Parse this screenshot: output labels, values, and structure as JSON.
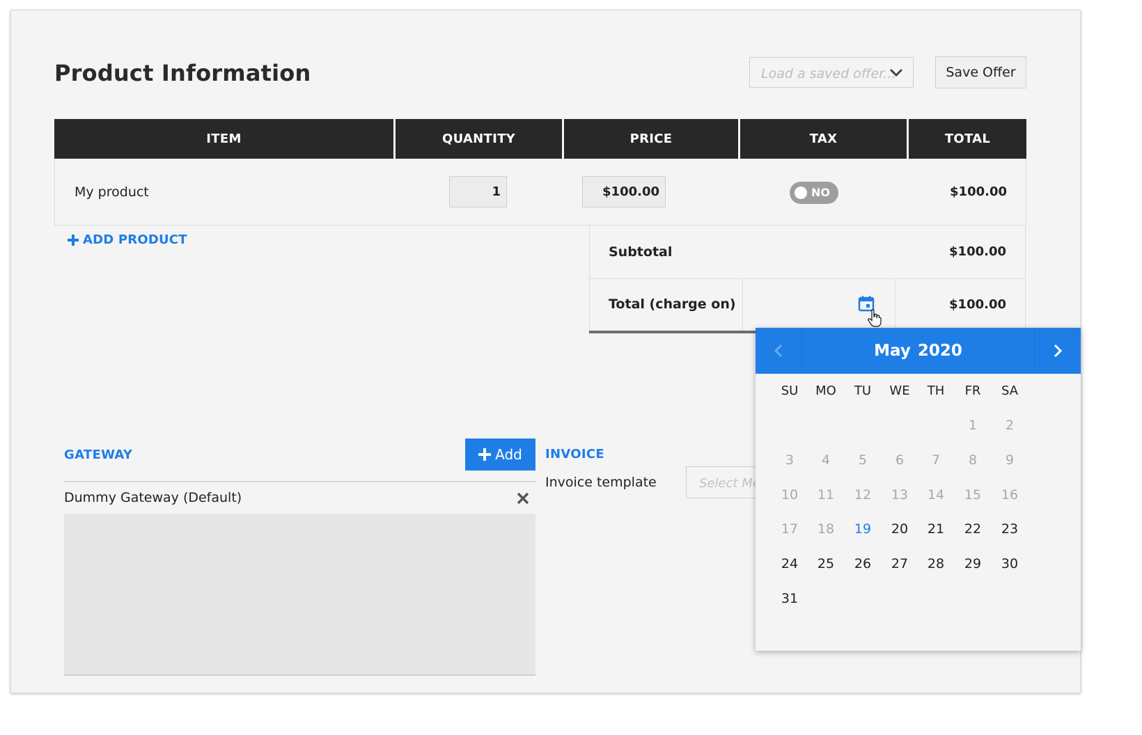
{
  "page_title": "Product Information",
  "load_offer_placeholder": "Load a saved offer...",
  "save_offer_label": "Save Offer",
  "table": {
    "headers": [
      "ITEM",
      "QUANTITY",
      "PRICE",
      "TAX",
      "TOTAL"
    ],
    "rows": [
      {
        "item": "My product",
        "quantity": "1",
        "price": "$100.00",
        "tax_toggle": "NO",
        "total": "$100.00"
      }
    ]
  },
  "add_product_label": "ADD PRODUCT",
  "summary": {
    "subtotal_label": "Subtotal",
    "subtotal_value": "$100.00",
    "total_label": "Total (charge on)",
    "total_value": "$100.00"
  },
  "gateway": {
    "title": "GATEWAY",
    "add_label": "Add",
    "item": "Dummy Gateway (Default)"
  },
  "invoice": {
    "title": "INVOICE",
    "template_label": "Invoice template",
    "template_placeholder": "Select Me"
  },
  "datepicker": {
    "month": "May",
    "year": "2020",
    "weekdays": [
      "SU",
      "MO",
      "TU",
      "WE",
      "TH",
      "FR",
      "SA"
    ],
    "first_weekday_index": 5,
    "days_in_month": 31,
    "today": 19
  },
  "colors": {
    "accent": "#1e7ee6",
    "header_bg": "#282828",
    "panel_bg": "#f4f4f4",
    "toggle_off": "#9e9e9e"
  },
  "icons": [
    "chevron-down-icon",
    "plus-icon",
    "calendar-icon",
    "hand-cursor-icon",
    "close-icon",
    "chevron-left-icon",
    "chevron-right-icon"
  ]
}
